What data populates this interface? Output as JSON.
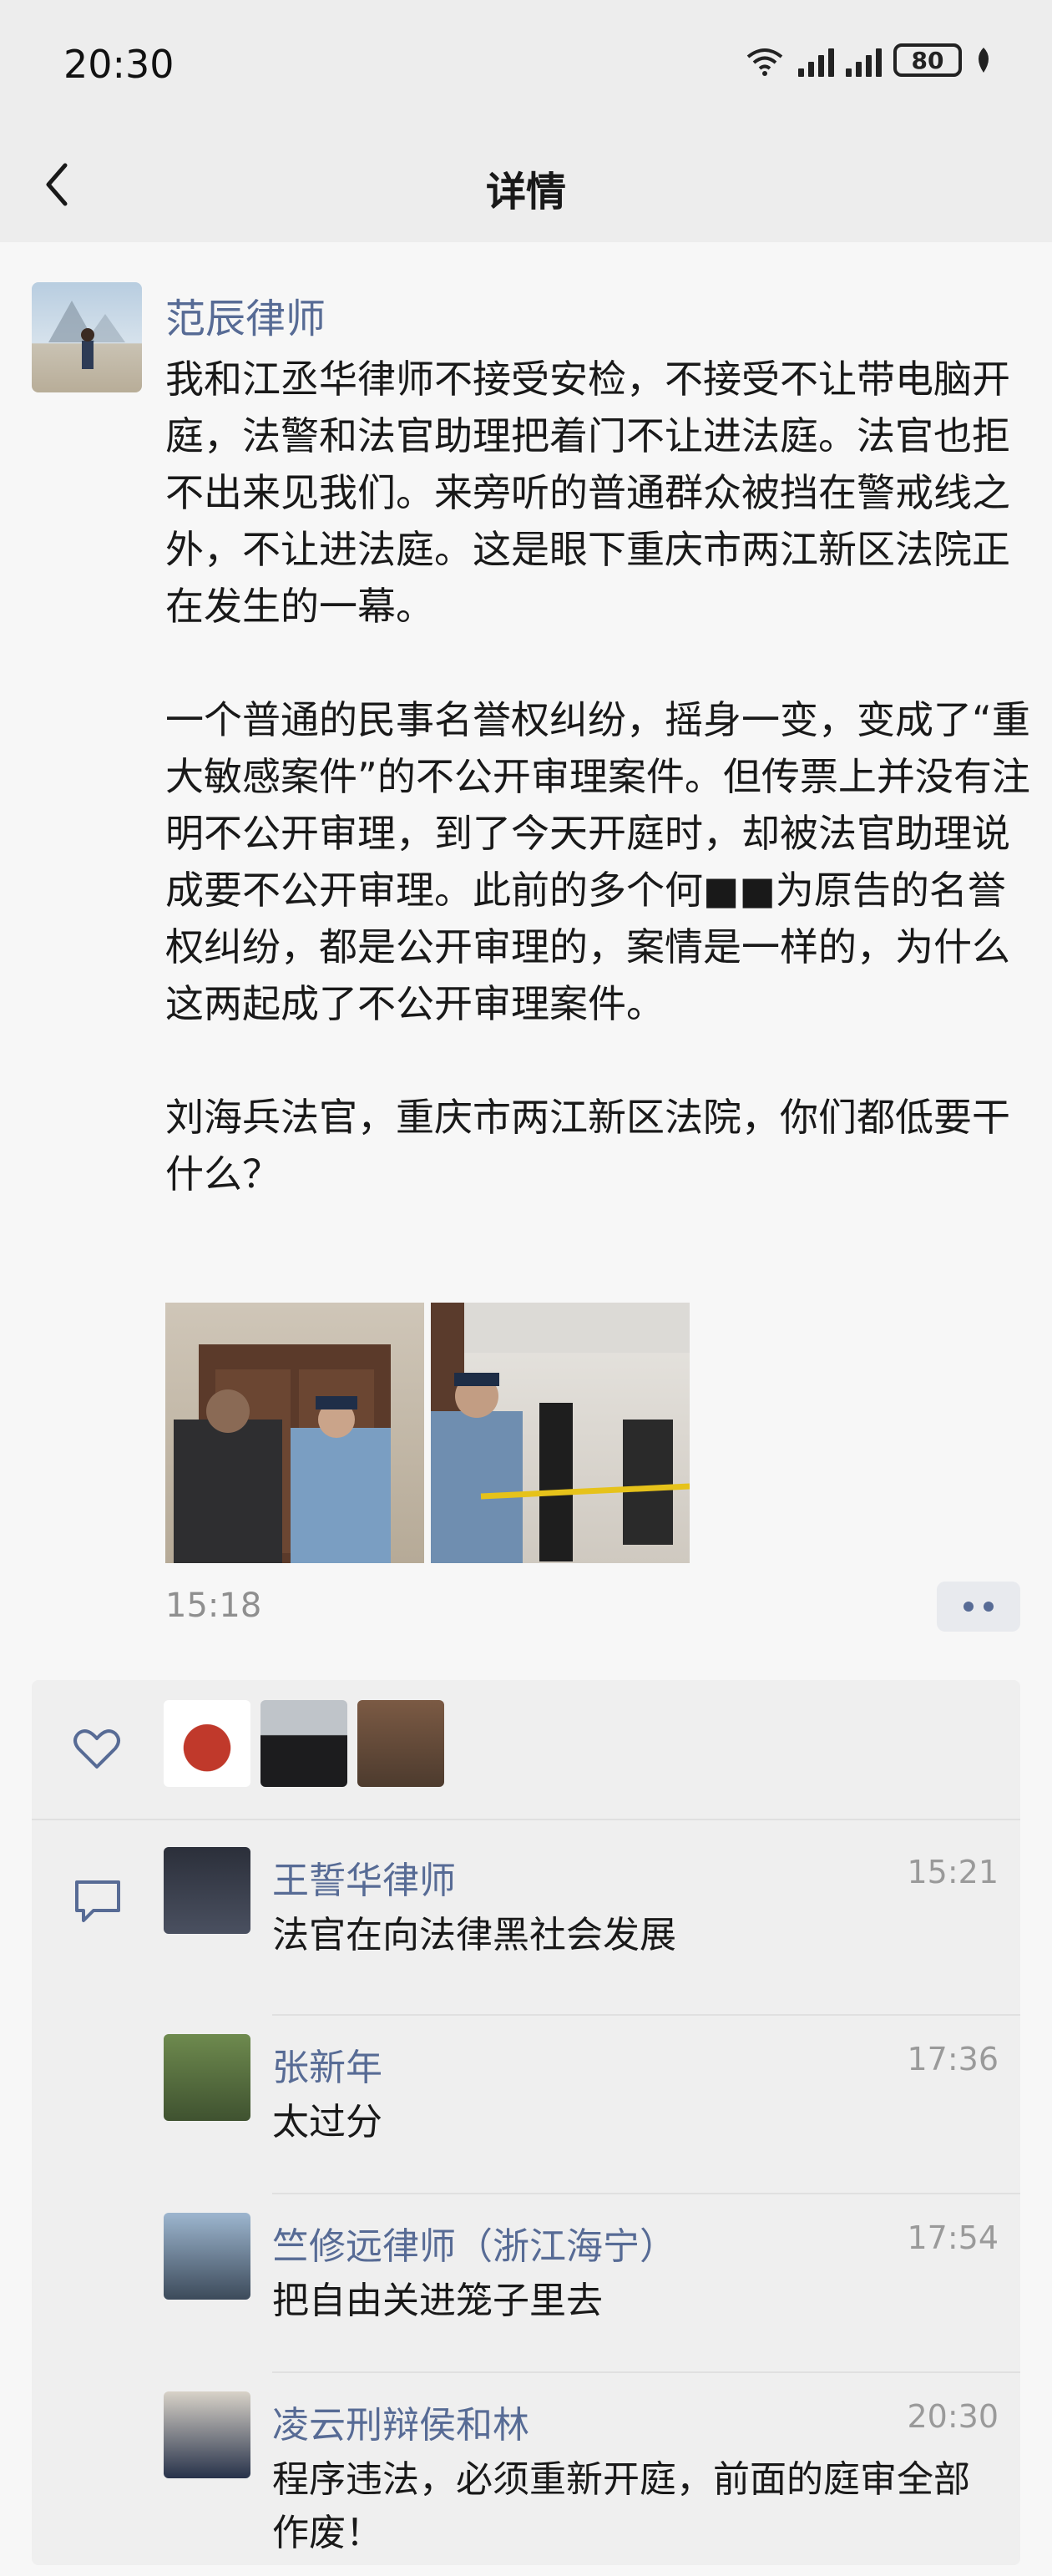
{
  "status_bar": {
    "time": "20:30",
    "battery": "80"
  },
  "nav": {
    "title": "详情"
  },
  "post": {
    "author": "范辰律师",
    "paragraphs": [
      "我和江丞华律师不接受安检，不接受不让带电脑开庭，法警和法官助理把着门不让进法庭。法官也拒不出来见我们。来旁听的普通群众被挡在警戒线之外，不让进法庭。这是眼下重庆市两江新区法院正在发生的一幕。",
      "一个普通的民事名誉权纠纷，摇身一变，变成了“重大敏感案件”的不公开审理案件。但传票上并没有注明不公开审理，到了今天开庭时，却被法官助理说成要不公开审理。此前的多个何■■为原告的名誉权纠纷，都是公开审理的，案情是一样的，为什么这两起成了不公开审理案件。",
      "刘海兵法官，重庆市两江新区法院，你们都低要干什么？"
    ],
    "time": "15:18"
  },
  "comments": [
    {
      "name": "王誓华律师",
      "time": "15:21",
      "text": "法官在向法律黑社会发展"
    },
    {
      "name": "张新年",
      "time": "17:36",
      "text": "太过分"
    },
    {
      "name": "竺修远律师（浙江海宁）",
      "time": "17:54",
      "text": "把自由关进笼子里去"
    },
    {
      "name": "凌云刑辩侯和林",
      "time": "20:30",
      "text": "程序违法，必须重新开庭，前面的庭审全部作废！"
    }
  ],
  "colors": {
    "link": "#576b95",
    "nav_bg": "#ededed",
    "page_bg": "#f7f7f7"
  }
}
